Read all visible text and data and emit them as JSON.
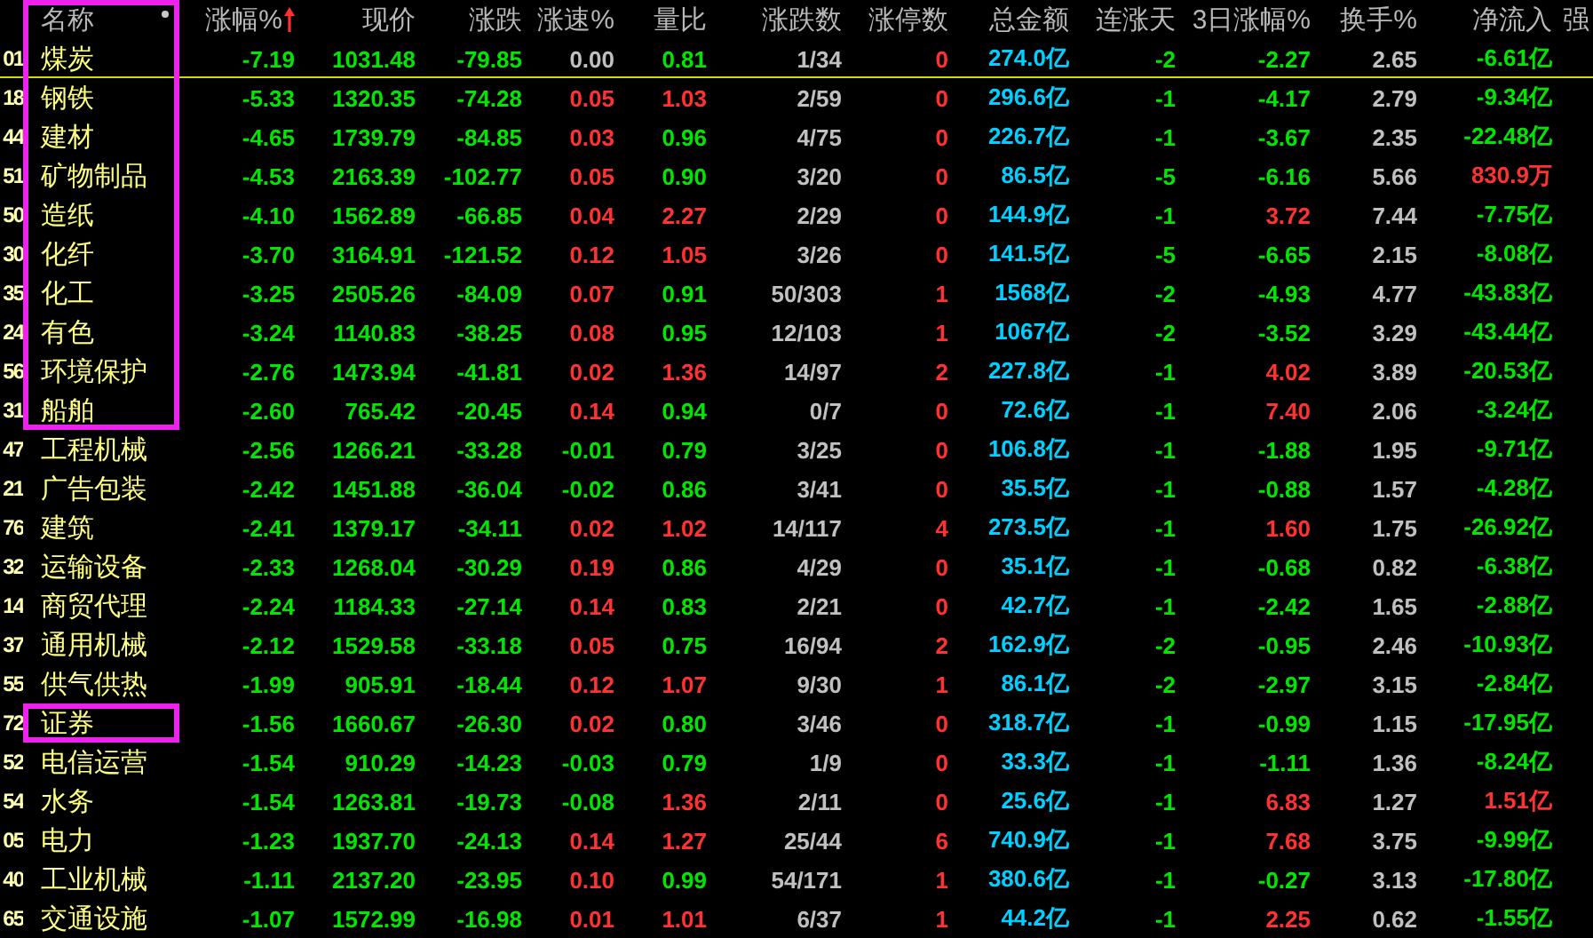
{
  "columns": [
    {
      "label": "名称",
      "sorted": false,
      "outlined": true
    },
    {
      "label": "涨幅%",
      "sorted": true,
      "outlined": false
    },
    {
      "label": "现价",
      "sorted": false,
      "outlined": false
    },
    {
      "label": "涨跌",
      "sorted": false,
      "outlined": false
    },
    {
      "label": "涨速%",
      "sorted": false,
      "outlined": false
    },
    {
      "label": "量比",
      "sorted": false,
      "outlined": false
    },
    {
      "label": "涨跌数",
      "sorted": false,
      "outlined": false
    },
    {
      "label": "涨停数",
      "sorted": false,
      "outlined": false
    },
    {
      "label": "总金额",
      "sorted": false,
      "outlined": false
    },
    {
      "label": "连涨天",
      "sorted": false,
      "outlined": false
    },
    {
      "label": "3日涨幅%",
      "sorted": false,
      "outlined": false
    },
    {
      "label": "换手%",
      "sorted": false,
      "outlined": false
    },
    {
      "label": "净流入",
      "sorted": false,
      "outlined": false
    },
    {
      "label": "强",
      "sorted": false,
      "outlined": false
    }
  ],
  "rows": [
    {
      "code": "01",
      "name": "煤炭",
      "selected": true,
      "outlined": true,
      "cells": [
        {
          "text": "-7.19",
          "color": "#00e600"
        },
        {
          "text": "1031.48",
          "color": "#00e600"
        },
        {
          "text": "-79.85",
          "color": "#00e600"
        },
        {
          "text": "0.00",
          "color": "#c0c0c0"
        },
        {
          "text": "0.81",
          "color": "#00e600"
        },
        {
          "text": "1/34",
          "color": "#c0c0c0"
        },
        {
          "text": "0",
          "color": "#ff3232"
        },
        {
          "text": "274.0亿",
          "color": "#00d0ff"
        },
        {
          "text": "-2",
          "color": "#00e600"
        },
        {
          "text": "-2.27",
          "color": "#00e600"
        },
        {
          "text": "2.65",
          "color": "#c0c0c0"
        },
        {
          "text": "-6.61亿",
          "color": "#00e600"
        }
      ]
    },
    {
      "code": "18",
      "name": "钢铁",
      "selected": false,
      "outlined": true,
      "cells": [
        {
          "text": "-5.33",
          "color": "#00e600"
        },
        {
          "text": "1320.35",
          "color": "#00e600"
        },
        {
          "text": "-74.28",
          "color": "#00e600"
        },
        {
          "text": "0.05",
          "color": "#ff3232"
        },
        {
          "text": "1.03",
          "color": "#ff3232"
        },
        {
          "text": "2/59",
          "color": "#c0c0c0"
        },
        {
          "text": "0",
          "color": "#ff3232"
        },
        {
          "text": "296.6亿",
          "color": "#00d0ff"
        },
        {
          "text": "-1",
          "color": "#00e600"
        },
        {
          "text": "-4.17",
          "color": "#00e600"
        },
        {
          "text": "2.79",
          "color": "#c0c0c0"
        },
        {
          "text": "-9.34亿",
          "color": "#00e600"
        }
      ]
    },
    {
      "code": "44",
      "name": "建材",
      "selected": false,
      "outlined": true,
      "cells": [
        {
          "text": "-4.65",
          "color": "#00e600"
        },
        {
          "text": "1739.79",
          "color": "#00e600"
        },
        {
          "text": "-84.85",
          "color": "#00e600"
        },
        {
          "text": "0.03",
          "color": "#ff3232"
        },
        {
          "text": "0.96",
          "color": "#00e600"
        },
        {
          "text": "4/75",
          "color": "#c0c0c0"
        },
        {
          "text": "0",
          "color": "#ff3232"
        },
        {
          "text": "226.7亿",
          "color": "#00d0ff"
        },
        {
          "text": "-1",
          "color": "#00e600"
        },
        {
          "text": "-3.67",
          "color": "#00e600"
        },
        {
          "text": "2.35",
          "color": "#c0c0c0"
        },
        {
          "text": "-22.48亿",
          "color": "#00e600"
        }
      ]
    },
    {
      "code": "51",
      "name": "矿物制品",
      "selected": false,
      "outlined": true,
      "cells": [
        {
          "text": "-4.53",
          "color": "#00e600"
        },
        {
          "text": "2163.39",
          "color": "#00e600"
        },
        {
          "text": "-102.77",
          "color": "#00e600"
        },
        {
          "text": "0.05",
          "color": "#ff3232"
        },
        {
          "text": "0.90",
          "color": "#00e600"
        },
        {
          "text": "3/20",
          "color": "#c0c0c0"
        },
        {
          "text": "0",
          "color": "#ff3232"
        },
        {
          "text": "86.5亿",
          "color": "#00d0ff"
        },
        {
          "text": "-5",
          "color": "#00e600"
        },
        {
          "text": "-6.16",
          "color": "#00e600"
        },
        {
          "text": "5.66",
          "color": "#c0c0c0"
        },
        {
          "text": "830.9万",
          "color": "#ff3232"
        }
      ]
    },
    {
      "code": "50",
      "name": "造纸",
      "selected": false,
      "outlined": true,
      "cells": [
        {
          "text": "-4.10",
          "color": "#00e600"
        },
        {
          "text": "1562.89",
          "color": "#00e600"
        },
        {
          "text": "-66.85",
          "color": "#00e600"
        },
        {
          "text": "0.04",
          "color": "#ff3232"
        },
        {
          "text": "2.27",
          "color": "#ff3232"
        },
        {
          "text": "2/29",
          "color": "#c0c0c0"
        },
        {
          "text": "0",
          "color": "#ff3232"
        },
        {
          "text": "144.9亿",
          "color": "#00d0ff"
        },
        {
          "text": "-1",
          "color": "#00e600"
        },
        {
          "text": "3.72",
          "color": "#ff3232"
        },
        {
          "text": "7.44",
          "color": "#c0c0c0"
        },
        {
          "text": "-7.75亿",
          "color": "#00e600"
        }
      ]
    },
    {
      "code": "30",
      "name": "化纤",
      "selected": false,
      "outlined": true,
      "cells": [
        {
          "text": "-3.70",
          "color": "#00e600"
        },
        {
          "text": "3164.91",
          "color": "#00e600"
        },
        {
          "text": "-121.52",
          "color": "#00e600"
        },
        {
          "text": "0.12",
          "color": "#ff3232"
        },
        {
          "text": "1.05",
          "color": "#ff3232"
        },
        {
          "text": "3/26",
          "color": "#c0c0c0"
        },
        {
          "text": "0",
          "color": "#ff3232"
        },
        {
          "text": "141.5亿",
          "color": "#00d0ff"
        },
        {
          "text": "-5",
          "color": "#00e600"
        },
        {
          "text": "-6.65",
          "color": "#00e600"
        },
        {
          "text": "2.15",
          "color": "#c0c0c0"
        },
        {
          "text": "-8.08亿",
          "color": "#00e600"
        }
      ]
    },
    {
      "code": "35",
      "name": "化工",
      "selected": false,
      "outlined": true,
      "cells": [
        {
          "text": "-3.25",
          "color": "#00e600"
        },
        {
          "text": "2505.26",
          "color": "#00e600"
        },
        {
          "text": "-84.09",
          "color": "#00e600"
        },
        {
          "text": "0.07",
          "color": "#ff3232"
        },
        {
          "text": "0.91",
          "color": "#00e600"
        },
        {
          "text": "50/303",
          "color": "#c0c0c0"
        },
        {
          "text": "1",
          "color": "#ff3232"
        },
        {
          "text": "1568亿",
          "color": "#00d0ff"
        },
        {
          "text": "-2",
          "color": "#00e600"
        },
        {
          "text": "-4.93",
          "color": "#00e600"
        },
        {
          "text": "4.77",
          "color": "#c0c0c0"
        },
        {
          "text": "-43.83亿",
          "color": "#00e600"
        }
      ]
    },
    {
      "code": "24",
      "name": "有色",
      "selected": false,
      "outlined": true,
      "cells": [
        {
          "text": "-3.24",
          "color": "#00e600"
        },
        {
          "text": "1140.83",
          "color": "#00e600"
        },
        {
          "text": "-38.25",
          "color": "#00e600"
        },
        {
          "text": "0.08",
          "color": "#ff3232"
        },
        {
          "text": "0.95",
          "color": "#00e600"
        },
        {
          "text": "12/103",
          "color": "#c0c0c0"
        },
        {
          "text": "1",
          "color": "#ff3232"
        },
        {
          "text": "1067亿",
          "color": "#00d0ff"
        },
        {
          "text": "-2",
          "color": "#00e600"
        },
        {
          "text": "-3.52",
          "color": "#00e600"
        },
        {
          "text": "3.29",
          "color": "#c0c0c0"
        },
        {
          "text": "-43.44亿",
          "color": "#00e600"
        }
      ]
    },
    {
      "code": "56",
      "name": "环境保护",
      "selected": false,
      "outlined": true,
      "cells": [
        {
          "text": "-2.76",
          "color": "#00e600"
        },
        {
          "text": "1473.94",
          "color": "#00e600"
        },
        {
          "text": "-41.81",
          "color": "#00e600"
        },
        {
          "text": "0.02",
          "color": "#ff3232"
        },
        {
          "text": "1.36",
          "color": "#ff3232"
        },
        {
          "text": "14/97",
          "color": "#c0c0c0"
        },
        {
          "text": "2",
          "color": "#ff3232"
        },
        {
          "text": "227.8亿",
          "color": "#00d0ff"
        },
        {
          "text": "-1",
          "color": "#00e600"
        },
        {
          "text": "4.02",
          "color": "#ff3232"
        },
        {
          "text": "3.89",
          "color": "#c0c0c0"
        },
        {
          "text": "-20.53亿",
          "color": "#00e600"
        }
      ]
    },
    {
      "code": "31",
      "name": "船舶",
      "selected": false,
      "outlined": true,
      "cells": [
        {
          "text": "-2.60",
          "color": "#00e600"
        },
        {
          "text": "765.42",
          "color": "#00e600"
        },
        {
          "text": "-20.45",
          "color": "#00e600"
        },
        {
          "text": "0.14",
          "color": "#ff3232"
        },
        {
          "text": "0.94",
          "color": "#00e600"
        },
        {
          "text": "0/7",
          "color": "#c0c0c0"
        },
        {
          "text": "0",
          "color": "#ff3232"
        },
        {
          "text": "72.6亿",
          "color": "#00d0ff"
        },
        {
          "text": "-1",
          "color": "#00e600"
        },
        {
          "text": "7.40",
          "color": "#ff3232"
        },
        {
          "text": "2.06",
          "color": "#c0c0c0"
        },
        {
          "text": "-3.24亿",
          "color": "#00e600"
        }
      ]
    },
    {
      "code": "47",
      "name": "工程机械",
      "selected": false,
      "outlined": false,
      "cells": [
        {
          "text": "-2.56",
          "color": "#00e600"
        },
        {
          "text": "1266.21",
          "color": "#00e600"
        },
        {
          "text": "-33.28",
          "color": "#00e600"
        },
        {
          "text": "-0.01",
          "color": "#00e600"
        },
        {
          "text": "0.79",
          "color": "#00e600"
        },
        {
          "text": "3/25",
          "color": "#c0c0c0"
        },
        {
          "text": "0",
          "color": "#ff3232"
        },
        {
          "text": "106.8亿",
          "color": "#00d0ff"
        },
        {
          "text": "-1",
          "color": "#00e600"
        },
        {
          "text": "-1.88",
          "color": "#00e600"
        },
        {
          "text": "1.95",
          "color": "#c0c0c0"
        },
        {
          "text": "-9.71亿",
          "color": "#00e600"
        }
      ]
    },
    {
      "code": "21",
      "name": "广告包装",
      "selected": false,
      "outlined": false,
      "cells": [
        {
          "text": "-2.42",
          "color": "#00e600"
        },
        {
          "text": "1451.88",
          "color": "#00e600"
        },
        {
          "text": "-36.04",
          "color": "#00e600"
        },
        {
          "text": "-0.02",
          "color": "#00e600"
        },
        {
          "text": "0.86",
          "color": "#00e600"
        },
        {
          "text": "3/41",
          "color": "#c0c0c0"
        },
        {
          "text": "0",
          "color": "#ff3232"
        },
        {
          "text": "35.5亿",
          "color": "#00d0ff"
        },
        {
          "text": "-1",
          "color": "#00e600"
        },
        {
          "text": "-0.88",
          "color": "#00e600"
        },
        {
          "text": "1.57",
          "color": "#c0c0c0"
        },
        {
          "text": "-4.28亿",
          "color": "#00e600"
        }
      ]
    },
    {
      "code": "76",
      "name": "建筑",
      "selected": false,
      "outlined": false,
      "cells": [
        {
          "text": "-2.41",
          "color": "#00e600"
        },
        {
          "text": "1379.17",
          "color": "#00e600"
        },
        {
          "text": "-34.11",
          "color": "#00e600"
        },
        {
          "text": "0.02",
          "color": "#ff3232"
        },
        {
          "text": "1.02",
          "color": "#ff3232"
        },
        {
          "text": "14/117",
          "color": "#c0c0c0"
        },
        {
          "text": "4",
          "color": "#ff3232"
        },
        {
          "text": "273.5亿",
          "color": "#00d0ff"
        },
        {
          "text": "-1",
          "color": "#00e600"
        },
        {
          "text": "1.60",
          "color": "#ff3232"
        },
        {
          "text": "1.75",
          "color": "#c0c0c0"
        },
        {
          "text": "-26.92亿",
          "color": "#00e600"
        }
      ]
    },
    {
      "code": "32",
      "name": "运输设备",
      "selected": false,
      "outlined": false,
      "cells": [
        {
          "text": "-2.33",
          "color": "#00e600"
        },
        {
          "text": "1268.04",
          "color": "#00e600"
        },
        {
          "text": "-30.29",
          "color": "#00e600"
        },
        {
          "text": "0.19",
          "color": "#ff3232"
        },
        {
          "text": "0.86",
          "color": "#00e600"
        },
        {
          "text": "4/29",
          "color": "#c0c0c0"
        },
        {
          "text": "0",
          "color": "#ff3232"
        },
        {
          "text": "35.1亿",
          "color": "#00d0ff"
        },
        {
          "text": "-1",
          "color": "#00e600"
        },
        {
          "text": "-0.68",
          "color": "#00e600"
        },
        {
          "text": "0.82",
          "color": "#c0c0c0"
        },
        {
          "text": "-6.38亿",
          "color": "#00e600"
        }
      ]
    },
    {
      "code": "14",
      "name": "商贸代理",
      "selected": false,
      "outlined": false,
      "cells": [
        {
          "text": "-2.24",
          "color": "#00e600"
        },
        {
          "text": "1184.33",
          "color": "#00e600"
        },
        {
          "text": "-27.14",
          "color": "#00e600"
        },
        {
          "text": "0.14",
          "color": "#ff3232"
        },
        {
          "text": "0.83",
          "color": "#00e600"
        },
        {
          "text": "2/21",
          "color": "#c0c0c0"
        },
        {
          "text": "0",
          "color": "#ff3232"
        },
        {
          "text": "42.7亿",
          "color": "#00d0ff"
        },
        {
          "text": "-1",
          "color": "#00e600"
        },
        {
          "text": "-2.42",
          "color": "#00e600"
        },
        {
          "text": "1.65",
          "color": "#c0c0c0"
        },
        {
          "text": "-2.88亿",
          "color": "#00e600"
        }
      ]
    },
    {
      "code": "37",
      "name": "通用机械",
      "selected": false,
      "outlined": false,
      "cells": [
        {
          "text": "-2.12",
          "color": "#00e600"
        },
        {
          "text": "1529.58",
          "color": "#00e600"
        },
        {
          "text": "-33.18",
          "color": "#00e600"
        },
        {
          "text": "0.05",
          "color": "#ff3232"
        },
        {
          "text": "0.75",
          "color": "#00e600"
        },
        {
          "text": "16/94",
          "color": "#c0c0c0"
        },
        {
          "text": "2",
          "color": "#ff3232"
        },
        {
          "text": "162.9亿",
          "color": "#00d0ff"
        },
        {
          "text": "-2",
          "color": "#00e600"
        },
        {
          "text": "-0.95",
          "color": "#00e600"
        },
        {
          "text": "2.46",
          "color": "#c0c0c0"
        },
        {
          "text": "-10.93亿",
          "color": "#00e600"
        }
      ]
    },
    {
      "code": "55",
      "name": "供气供热",
      "selected": false,
      "outlined": false,
      "cells": [
        {
          "text": "-1.99",
          "color": "#00e600"
        },
        {
          "text": "905.91",
          "color": "#00e600"
        },
        {
          "text": "-18.44",
          "color": "#00e600"
        },
        {
          "text": "0.12",
          "color": "#ff3232"
        },
        {
          "text": "1.07",
          "color": "#ff3232"
        },
        {
          "text": "9/30",
          "color": "#c0c0c0"
        },
        {
          "text": "1",
          "color": "#ff3232"
        },
        {
          "text": "86.1亿",
          "color": "#00d0ff"
        },
        {
          "text": "-2",
          "color": "#00e600"
        },
        {
          "text": "-2.97",
          "color": "#00e600"
        },
        {
          "text": "3.15",
          "color": "#c0c0c0"
        },
        {
          "text": "-2.84亿",
          "color": "#00e600"
        }
      ]
    },
    {
      "code": "72",
      "name": "证券",
      "selected": false,
      "outlined": true,
      "cells": [
        {
          "text": "-1.56",
          "color": "#00e600"
        },
        {
          "text": "1660.67",
          "color": "#00e600"
        },
        {
          "text": "-26.30",
          "color": "#00e600"
        },
        {
          "text": "0.02",
          "color": "#ff3232"
        },
        {
          "text": "0.80",
          "color": "#00e600"
        },
        {
          "text": "3/46",
          "color": "#c0c0c0"
        },
        {
          "text": "0",
          "color": "#ff3232"
        },
        {
          "text": "318.7亿",
          "color": "#00d0ff"
        },
        {
          "text": "-1",
          "color": "#00e600"
        },
        {
          "text": "-0.99",
          "color": "#00e600"
        },
        {
          "text": "1.15",
          "color": "#c0c0c0"
        },
        {
          "text": "-17.95亿",
          "color": "#00e600"
        }
      ]
    },
    {
      "code": "52",
      "name": "电信运营",
      "selected": false,
      "outlined": false,
      "cells": [
        {
          "text": "-1.54",
          "color": "#00e600"
        },
        {
          "text": "910.29",
          "color": "#00e600"
        },
        {
          "text": "-14.23",
          "color": "#00e600"
        },
        {
          "text": "-0.03",
          "color": "#00e600"
        },
        {
          "text": "0.79",
          "color": "#00e600"
        },
        {
          "text": "1/9",
          "color": "#c0c0c0"
        },
        {
          "text": "0",
          "color": "#ff3232"
        },
        {
          "text": "33.3亿",
          "color": "#00d0ff"
        },
        {
          "text": "-1",
          "color": "#00e600"
        },
        {
          "text": "-1.11",
          "color": "#00e600"
        },
        {
          "text": "1.36",
          "color": "#c0c0c0"
        },
        {
          "text": "-8.24亿",
          "color": "#00e600"
        }
      ]
    },
    {
      "code": "54",
      "name": "水务",
      "selected": false,
      "outlined": false,
      "cells": [
        {
          "text": "-1.54",
          "color": "#00e600"
        },
        {
          "text": "1263.81",
          "color": "#00e600"
        },
        {
          "text": "-19.73",
          "color": "#00e600"
        },
        {
          "text": "-0.08",
          "color": "#00e600"
        },
        {
          "text": "1.36",
          "color": "#ff3232"
        },
        {
          "text": "2/11",
          "color": "#c0c0c0"
        },
        {
          "text": "0",
          "color": "#ff3232"
        },
        {
          "text": "25.6亿",
          "color": "#00d0ff"
        },
        {
          "text": "-1",
          "color": "#00e600"
        },
        {
          "text": "6.83",
          "color": "#ff3232"
        },
        {
          "text": "1.27",
          "color": "#c0c0c0"
        },
        {
          "text": "1.51亿",
          "color": "#ff3232"
        }
      ]
    },
    {
      "code": "05",
      "name": "电力",
      "selected": false,
      "outlined": false,
      "cells": [
        {
          "text": "-1.23",
          "color": "#00e600"
        },
        {
          "text": "1937.70",
          "color": "#00e600"
        },
        {
          "text": "-24.13",
          "color": "#00e600"
        },
        {
          "text": "0.14",
          "color": "#ff3232"
        },
        {
          "text": "1.27",
          "color": "#ff3232"
        },
        {
          "text": "25/44",
          "color": "#c0c0c0"
        },
        {
          "text": "6",
          "color": "#ff3232"
        },
        {
          "text": "740.9亿",
          "color": "#00d0ff"
        },
        {
          "text": "-1",
          "color": "#00e600"
        },
        {
          "text": "7.68",
          "color": "#ff3232"
        },
        {
          "text": "3.75",
          "color": "#c0c0c0"
        },
        {
          "text": "-9.99亿",
          "color": "#00e600"
        }
      ]
    },
    {
      "code": "40",
      "name": "工业机械",
      "selected": false,
      "outlined": false,
      "cells": [
        {
          "text": "-1.11",
          "color": "#00e600"
        },
        {
          "text": "2137.20",
          "color": "#00e600"
        },
        {
          "text": "-23.95",
          "color": "#00e600"
        },
        {
          "text": "0.10",
          "color": "#ff3232"
        },
        {
          "text": "0.99",
          "color": "#00e600"
        },
        {
          "text": "54/171",
          "color": "#c0c0c0"
        },
        {
          "text": "1",
          "color": "#ff3232"
        },
        {
          "text": "380.6亿",
          "color": "#00d0ff"
        },
        {
          "text": "-1",
          "color": "#00e600"
        },
        {
          "text": "-0.27",
          "color": "#00e600"
        },
        {
          "text": "3.13",
          "color": "#c0c0c0"
        },
        {
          "text": "-17.80亿",
          "color": "#00e600"
        }
      ]
    },
    {
      "code": "65",
      "name": "交通设施",
      "selected": false,
      "outlined": false,
      "cells": [
        {
          "text": "-1.07",
          "color": "#00e600"
        },
        {
          "text": "1572.99",
          "color": "#00e600"
        },
        {
          "text": "-16.98",
          "color": "#00e600"
        },
        {
          "text": "0.01",
          "color": "#ff3232"
        },
        {
          "text": "1.01",
          "color": "#ff3232"
        },
        {
          "text": "6/37",
          "color": "#c0c0c0"
        },
        {
          "text": "1",
          "color": "#ff3232"
        },
        {
          "text": "44.2亿",
          "color": "#00d0ff"
        },
        {
          "text": "-1",
          "color": "#00e600"
        },
        {
          "text": "2.25",
          "color": "#ff3232"
        },
        {
          "text": "0.62",
          "color": "#c0c0c0"
        },
        {
          "text": "-1.55亿",
          "color": "#00e600"
        }
      ]
    }
  ]
}
